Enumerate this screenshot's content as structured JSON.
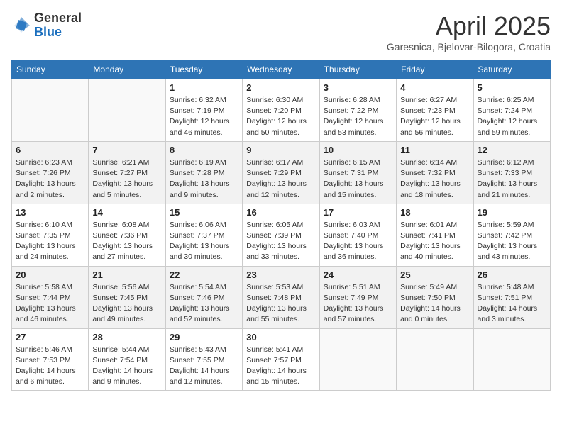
{
  "header": {
    "logo_general": "General",
    "logo_blue": "Blue",
    "month_title": "April 2025",
    "subtitle": "Garesnica, Bjelovar-Bilogora, Croatia"
  },
  "weekdays": [
    "Sunday",
    "Monday",
    "Tuesday",
    "Wednesday",
    "Thursday",
    "Friday",
    "Saturday"
  ],
  "weeks": [
    [
      {
        "day": "",
        "info": ""
      },
      {
        "day": "",
        "info": ""
      },
      {
        "day": "1",
        "info": "Sunrise: 6:32 AM\nSunset: 7:19 PM\nDaylight: 12 hours and 46 minutes."
      },
      {
        "day": "2",
        "info": "Sunrise: 6:30 AM\nSunset: 7:20 PM\nDaylight: 12 hours and 50 minutes."
      },
      {
        "day": "3",
        "info": "Sunrise: 6:28 AM\nSunset: 7:22 PM\nDaylight: 12 hours and 53 minutes."
      },
      {
        "day": "4",
        "info": "Sunrise: 6:27 AM\nSunset: 7:23 PM\nDaylight: 12 hours and 56 minutes."
      },
      {
        "day": "5",
        "info": "Sunrise: 6:25 AM\nSunset: 7:24 PM\nDaylight: 12 hours and 59 minutes."
      }
    ],
    [
      {
        "day": "6",
        "info": "Sunrise: 6:23 AM\nSunset: 7:26 PM\nDaylight: 13 hours and 2 minutes."
      },
      {
        "day": "7",
        "info": "Sunrise: 6:21 AM\nSunset: 7:27 PM\nDaylight: 13 hours and 5 minutes."
      },
      {
        "day": "8",
        "info": "Sunrise: 6:19 AM\nSunset: 7:28 PM\nDaylight: 13 hours and 9 minutes."
      },
      {
        "day": "9",
        "info": "Sunrise: 6:17 AM\nSunset: 7:29 PM\nDaylight: 13 hours and 12 minutes."
      },
      {
        "day": "10",
        "info": "Sunrise: 6:15 AM\nSunset: 7:31 PM\nDaylight: 13 hours and 15 minutes."
      },
      {
        "day": "11",
        "info": "Sunrise: 6:14 AM\nSunset: 7:32 PM\nDaylight: 13 hours and 18 minutes."
      },
      {
        "day": "12",
        "info": "Sunrise: 6:12 AM\nSunset: 7:33 PM\nDaylight: 13 hours and 21 minutes."
      }
    ],
    [
      {
        "day": "13",
        "info": "Sunrise: 6:10 AM\nSunset: 7:35 PM\nDaylight: 13 hours and 24 minutes."
      },
      {
        "day": "14",
        "info": "Sunrise: 6:08 AM\nSunset: 7:36 PM\nDaylight: 13 hours and 27 minutes."
      },
      {
        "day": "15",
        "info": "Sunrise: 6:06 AM\nSunset: 7:37 PM\nDaylight: 13 hours and 30 minutes."
      },
      {
        "day": "16",
        "info": "Sunrise: 6:05 AM\nSunset: 7:39 PM\nDaylight: 13 hours and 33 minutes."
      },
      {
        "day": "17",
        "info": "Sunrise: 6:03 AM\nSunset: 7:40 PM\nDaylight: 13 hours and 36 minutes."
      },
      {
        "day": "18",
        "info": "Sunrise: 6:01 AM\nSunset: 7:41 PM\nDaylight: 13 hours and 40 minutes."
      },
      {
        "day": "19",
        "info": "Sunrise: 5:59 AM\nSunset: 7:42 PM\nDaylight: 13 hours and 43 minutes."
      }
    ],
    [
      {
        "day": "20",
        "info": "Sunrise: 5:58 AM\nSunset: 7:44 PM\nDaylight: 13 hours and 46 minutes."
      },
      {
        "day": "21",
        "info": "Sunrise: 5:56 AM\nSunset: 7:45 PM\nDaylight: 13 hours and 49 minutes."
      },
      {
        "day": "22",
        "info": "Sunrise: 5:54 AM\nSunset: 7:46 PM\nDaylight: 13 hours and 52 minutes."
      },
      {
        "day": "23",
        "info": "Sunrise: 5:53 AM\nSunset: 7:48 PM\nDaylight: 13 hours and 55 minutes."
      },
      {
        "day": "24",
        "info": "Sunrise: 5:51 AM\nSunset: 7:49 PM\nDaylight: 13 hours and 57 minutes."
      },
      {
        "day": "25",
        "info": "Sunrise: 5:49 AM\nSunset: 7:50 PM\nDaylight: 14 hours and 0 minutes."
      },
      {
        "day": "26",
        "info": "Sunrise: 5:48 AM\nSunset: 7:51 PM\nDaylight: 14 hours and 3 minutes."
      }
    ],
    [
      {
        "day": "27",
        "info": "Sunrise: 5:46 AM\nSunset: 7:53 PM\nDaylight: 14 hours and 6 minutes."
      },
      {
        "day": "28",
        "info": "Sunrise: 5:44 AM\nSunset: 7:54 PM\nDaylight: 14 hours and 9 minutes."
      },
      {
        "day": "29",
        "info": "Sunrise: 5:43 AM\nSunset: 7:55 PM\nDaylight: 14 hours and 12 minutes."
      },
      {
        "day": "30",
        "info": "Sunrise: 5:41 AM\nSunset: 7:57 PM\nDaylight: 14 hours and 15 minutes."
      },
      {
        "day": "",
        "info": ""
      },
      {
        "day": "",
        "info": ""
      },
      {
        "day": "",
        "info": ""
      }
    ]
  ]
}
